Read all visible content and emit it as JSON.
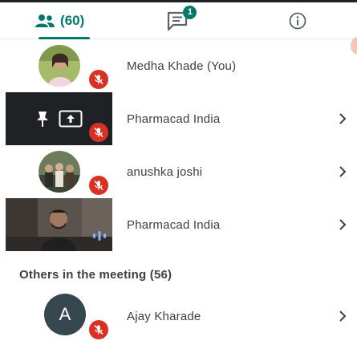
{
  "tabs": {
    "people": {
      "label": "(60)",
      "icon": "people-icon"
    },
    "chat": {
      "badge": "1",
      "icon": "chat-icon"
    },
    "info": {
      "icon": "info-icon"
    }
  },
  "participants": [
    {
      "name": "Medha Khade (You)",
      "muted": true
    },
    {
      "name": "Pharmacad India",
      "muted": true,
      "presenting": true
    },
    {
      "name": "anushka joshi",
      "muted": true
    },
    {
      "name": "Pharmacad India",
      "speaking": true
    }
  ],
  "others": {
    "title": "Others in the meeting (56)",
    "participants": [
      {
        "name": "Ajay Kharade",
        "initial": "A",
        "muted": true
      }
    ]
  },
  "colors": {
    "accent": "#00796b",
    "mic_off": "#d93025",
    "speaking": "#8ab4f8",
    "avatar_bg": "#37474f"
  }
}
